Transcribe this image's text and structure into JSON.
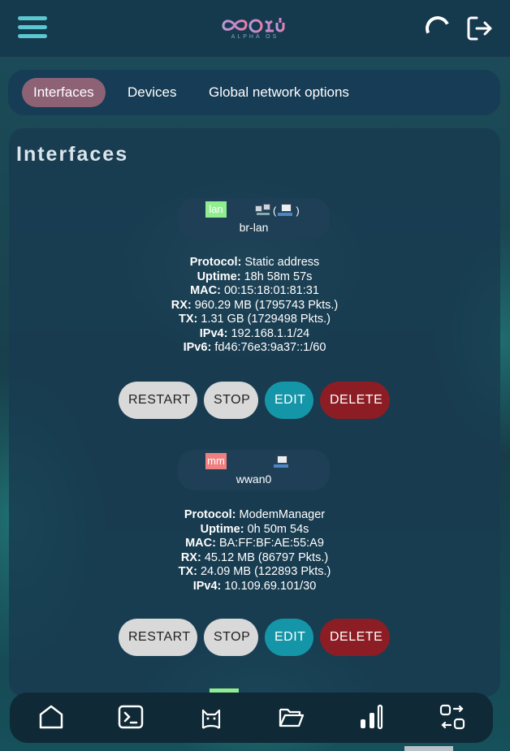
{
  "header": {
    "logo_sub": "ALPHA OS",
    "icons": [
      "menu-icon",
      "logo",
      "loading-spinner-icon",
      "logout-icon"
    ]
  },
  "tabs": [
    {
      "label": "Interfaces",
      "active": true
    },
    {
      "label": "Devices",
      "active": false
    },
    {
      "label": "Global network options",
      "active": false
    }
  ],
  "panel": {
    "title": "Interfaces"
  },
  "interfaces": [
    {
      "name": "lan",
      "badge_color": "#90ee90",
      "device": "br-lan",
      "device_paren_open": "(",
      "device_paren_close": ")",
      "protocol_label": "Protocol:",
      "protocol": "Static address",
      "uptime_label": "Uptime:",
      "uptime": "18h 58m 57s",
      "mac_label": "MAC:",
      "mac": "00:15:18:01:81:31",
      "rx_label": "RX:",
      "rx": "960.29 MB (1795743 Pkts.)",
      "tx_label": "TX:",
      "tx": "1.31 GB (1729498 Pkts.)",
      "ipv4_label": "IPv4:",
      "ipv4": "192.168.1.1/24",
      "ipv6_label": "IPv6:",
      "ipv6": "fd46:76e3:9a37::1/60"
    },
    {
      "name": "mm",
      "badge_color": "#f08080",
      "device": "wwan0",
      "protocol_label": "Protocol:",
      "protocol": "ModemManager",
      "uptime_label": "Uptime:",
      "uptime": "0h 50m 54s",
      "mac_label": "MAC:",
      "mac": "BA:FF:BF:AE:55:A9",
      "rx_label": "RX:",
      "rx": "45.12 MB (86797 Pkts.)",
      "tx_label": "TX:",
      "tx": "24.09 MB (122893 Pkts.)",
      "ipv4_label": "IPv4:",
      "ipv4": "10.109.69.101/30"
    }
  ],
  "buttons": {
    "restart": "RESTART",
    "stop": "STOP",
    "edit": "EDIT",
    "delete": "DELETE"
  },
  "bottom_nav": [
    "home-icon",
    "terminal-icon",
    "cat-icon",
    "folder-icon",
    "signal-bars-icon",
    "swap-icon"
  ],
  "colors": {
    "accent": "#5bc7d0",
    "active_tab": "#8d6275",
    "edit": "#1596a8",
    "delete": "#8c1d24"
  }
}
